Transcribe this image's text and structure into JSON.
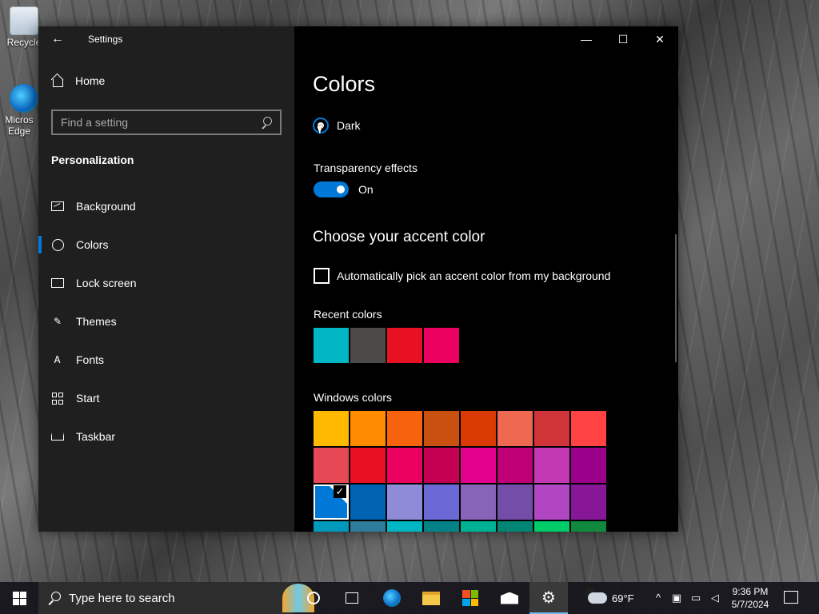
{
  "desktop": {
    "icons": [
      {
        "label": "Recycle"
      },
      {
        "label": "Micros Edge"
      }
    ]
  },
  "window": {
    "title": "Settings",
    "sidebar": {
      "home_label": "Home",
      "search_placeholder": "Find a setting",
      "section_title": "Personalization",
      "items": [
        {
          "label": "Background",
          "icon": "image-icon"
        },
        {
          "label": "Colors",
          "icon": "palette-icon",
          "active": true
        },
        {
          "label": "Lock screen",
          "icon": "lock-screen-icon"
        },
        {
          "label": "Themes",
          "icon": "themes-icon"
        },
        {
          "label": "Fonts",
          "icon": "fonts-icon"
        },
        {
          "label": "Start",
          "icon": "start-icon"
        },
        {
          "label": "Taskbar",
          "icon": "taskbar-icon"
        }
      ]
    },
    "content": {
      "heading": "Colors",
      "mode_option": "Dark",
      "transparency_label": "Transparency effects",
      "transparency_state": "On",
      "accent_heading": "Choose your accent color",
      "auto_pick_label": "Automatically pick an accent color from my background",
      "recent_label": "Recent colors",
      "windows_label": "Windows colors",
      "recent_colors": [
        "#00b7c3",
        "#4c4a48",
        "#e81123",
        "#ea005e"
      ],
      "windows_colors": [
        "#ffb900",
        "#ff8c00",
        "#f7630c",
        "#ca5010",
        "#da3b01",
        "#ef6950",
        "#d13438",
        "#ff4343",
        "#e74856",
        "#e81123",
        "#ea005e",
        "#c30052",
        "#e3008c",
        "#bf0077",
        "#c239b3",
        "#9a0089",
        "#0078d7",
        "#0063b1",
        "#8e8cd8",
        "#6b69d6",
        "#8764b8",
        "#744da9",
        "#b146c2",
        "#881798",
        "#0099bc",
        "#2d7d9a",
        "#00b7c3",
        "#038387",
        "#00b294",
        "#018574",
        "#00cc6a",
        "#10893e"
      ],
      "selected_color": "#0078d7"
    }
  },
  "taskbar": {
    "search_text": "Type here to search",
    "weather_temp": "69°F",
    "time": "9:36 PM",
    "date": "5/7/2024"
  }
}
